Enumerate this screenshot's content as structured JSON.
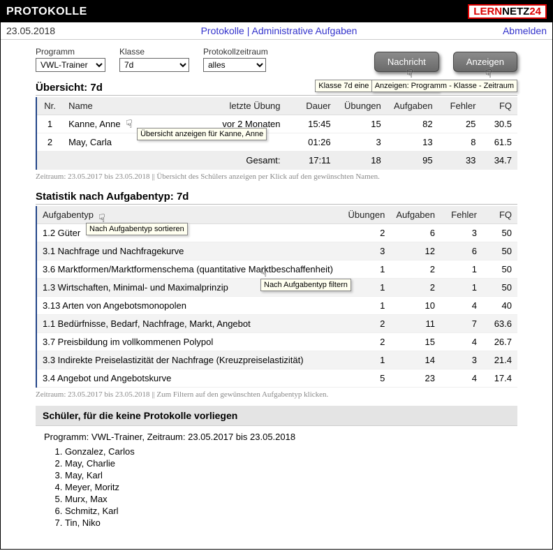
{
  "header": {
    "title": "Protokolle",
    "logo": {
      "lern": "LERN",
      "netz": "NETZ",
      "z24": "24"
    }
  },
  "subbar": {
    "date": "23.05.2018",
    "link_protokolle": "Protokolle",
    "sep": " | ",
    "link_admin": "Administrative Aufgaben",
    "logout": "Abmelden"
  },
  "controls": {
    "programm_label": "Programm",
    "programm_value": "VWL-Trainer",
    "klasse_label": "Klasse",
    "klasse_value": "7d",
    "zeitraum_label": "Protokollzeitraum",
    "zeitraum_value": "alles",
    "nachricht_btn": "Nachricht",
    "nachricht_tip": "Klasse 7d eine Nachricht schicken",
    "anzeigen_btn": "Anzeigen",
    "anzeigen_tip": "Anzeigen: Programm - Klasse - Zeitraum"
  },
  "overview": {
    "title": "Übersicht: 7d",
    "cols": {
      "nr": "Nr.",
      "name": "Name",
      "letzte": "letzte Übung",
      "dauer": "Dauer",
      "ueb": "Übungen",
      "auf": "Aufgaben",
      "fehler": "Fehler",
      "fq": "FQ"
    },
    "rows": [
      {
        "nr": "1",
        "name": "Kanne, Anne",
        "letzte": "vor 2 Monaten",
        "dauer": "15:45",
        "ueb": "15",
        "auf": "82",
        "fehler": "25",
        "fq": "30.5"
      },
      {
        "nr": "2",
        "name": "May, Carla",
        "letzte": "",
        "dauer": "01:26",
        "ueb": "3",
        "auf": "13",
        "fehler": "8",
        "fq": "61.5"
      }
    ],
    "row0_tip": "Übersicht anzeigen für Kanne, Anne",
    "total_label": "Gesamt:",
    "total": {
      "dauer": "17:11",
      "ueb": "18",
      "auf": "95",
      "fehler": "33",
      "fq": "34.7"
    },
    "foot": "Zeitraum: 23.05.2017 bis 23.05.2018 || Übersicht des Schülers anzeigen per Klick auf den gewünschten Namen."
  },
  "stats": {
    "title": "Statistik nach Aufgabentyp: 7d",
    "cols": {
      "typ": "Aufgabentyp",
      "ueb": "Übungen",
      "auf": "Aufgaben",
      "fehler": "Fehler",
      "fq": "FQ"
    },
    "typ_tip_sort": "Nach Aufgabentyp sortieren",
    "typ_tip_filter": "Nach Aufgabentyp filtern",
    "rows": [
      {
        "typ": "1.2 Güter",
        "ueb": "2",
        "auf": "6",
        "fehler": "3",
        "fq": "50"
      },
      {
        "typ": "3.1 Nachfrage und Nachfragekurve",
        "ueb": "3",
        "auf": "12",
        "fehler": "6",
        "fq": "50"
      },
      {
        "typ": "3.6 Marktformen/Marktformenschema (quantitative Marktbeschaffenheit)",
        "ueb": "1",
        "auf": "2",
        "fehler": "1",
        "fq": "50"
      },
      {
        "typ": "1.3 Wirtschaften, Minimal- und Maximalprinzip",
        "ueb": "1",
        "auf": "2",
        "fehler": "1",
        "fq": "50"
      },
      {
        "typ": "3.13 Arten von Angebotsmonopolen",
        "ueb": "1",
        "auf": "10",
        "fehler": "4",
        "fq": "40"
      },
      {
        "typ": "1.1 Bedürfnisse, Bedarf, Nachfrage, Markt, Angebot",
        "ueb": "2",
        "auf": "11",
        "fehler": "7",
        "fq": "63.6"
      },
      {
        "typ": "3.7 Preisbildung im vollkommenen Polypol",
        "ueb": "2",
        "auf": "15",
        "fehler": "4",
        "fq": "26.7"
      },
      {
        "typ": "3.3 Indirekte Preiselastizität der Nachfrage (Kreuzpreiselastizität)",
        "ueb": "1",
        "auf": "14",
        "fehler": "3",
        "fq": "21.4"
      },
      {
        "typ": "3.4 Angebot und Angebotskurve",
        "ueb": "5",
        "auf": "23",
        "fehler": "4",
        "fq": "17.4"
      }
    ],
    "foot": "Zeitraum: 23.05.2017 bis 23.05.2018 || Zum Filtern auf den gewünschten Aufgabentyp klicken."
  },
  "noproto": {
    "heading": "Schüler, für die keine Protokolle vorliegen",
    "line": "Programm: VWL-Trainer, Zeitraum: 23.05.2017 bis 23.05.2018",
    "students": [
      "Gonzalez, Carlos",
      "May, Charlie",
      "May, Karl",
      "Meyer, Moritz",
      "Murx, Max",
      "Schmitz, Karl",
      "Tin, Niko"
    ]
  }
}
